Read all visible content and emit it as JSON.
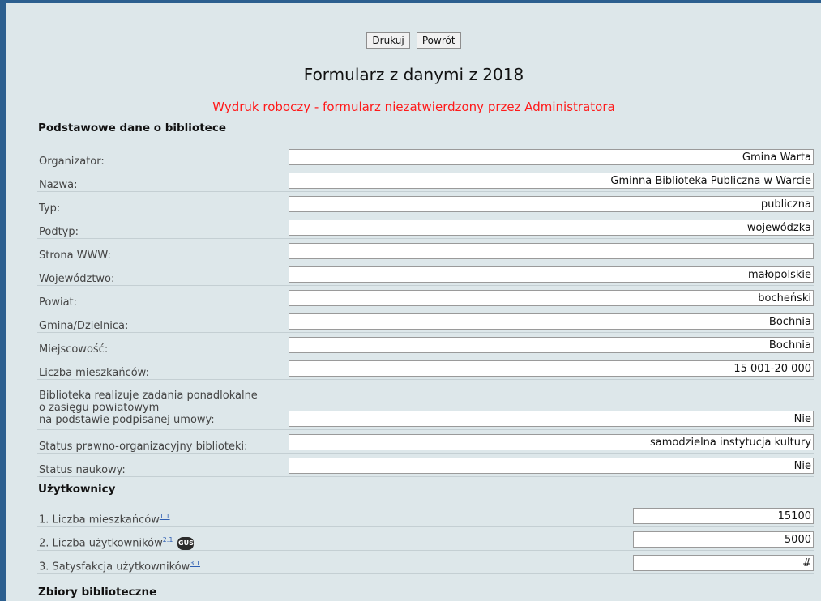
{
  "toolbar": {
    "print_label": "Drukuj",
    "back_label": "Powrót"
  },
  "header": {
    "title": "Formularz z danymi z 2018",
    "notice": "Wydruk roboczy - formularz niezatwierdzony przez Administratora"
  },
  "basic": {
    "heading": "Podstawowe dane o bibliotece",
    "rows": [
      {
        "label": "Organizator:",
        "value": "Gmina Warta"
      },
      {
        "label": "Nazwa:",
        "value": "Gminna Biblioteka Publiczna w Warcie"
      },
      {
        "label": "Typ:",
        "value": "publiczna"
      },
      {
        "label": "Podtyp:",
        "value": "wojewódzka"
      },
      {
        "label": "Strona WWW:",
        "value": ""
      },
      {
        "label": "Województwo:",
        "value": "małopolskie"
      },
      {
        "label": "Powiat:",
        "value": "bocheński"
      },
      {
        "label": "Gmina/Dzielnica:",
        "value": "Bochnia"
      },
      {
        "label": "Miejscowość:",
        "value": "Bochnia"
      },
      {
        "label": "Liczba mieszkańców:",
        "value": "15 001-20 000"
      },
      {
        "label_lines": [
          "Biblioteka realizuje zadania ponadlokalne",
          "o zasięgu powiatowym",
          "na podstawie podpisanej umowy:"
        ],
        "value": "Nie"
      },
      {
        "label": "Status prawno-organizacyjny biblioteki:",
        "value": "samodzielna instytucja kultury"
      },
      {
        "label": "Status naukowy:",
        "value": "Nie"
      }
    ]
  },
  "users": {
    "heading": "Użytkownicy",
    "rows": [
      {
        "label": "1. Liczba mieszkańców",
        "ref": "1.1",
        "value": "15100"
      },
      {
        "label": "2. Liczba użytkowników",
        "ref": "2.1",
        "badge": "GUS",
        "value": "5000"
      },
      {
        "label": "3. Satysfakcja użytkowników",
        "ref": "3.1",
        "value": "#"
      }
    ]
  },
  "collections": {
    "heading": "Zbiory biblioteczne"
  },
  "colors": {
    "frame": "#2c5f8f",
    "panel": "#dde7ea",
    "notice": "#ff1a1a",
    "link": "#2f5fb3"
  },
  "icons": {
    "gus_badge": "gus-icon"
  }
}
